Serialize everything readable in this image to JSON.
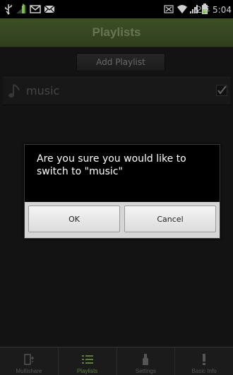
{
  "status_bar": {
    "time": "오후 5:04"
  },
  "header": {
    "title": "Playlists"
  },
  "toolbar": {
    "add_playlist_label": "Add Playlist"
  },
  "playlists": [
    {
      "name": "music",
      "checked": true
    }
  ],
  "dialog": {
    "message": "Are you sure you would like to switch to \"music\"",
    "ok_label": "OK",
    "cancel_label": "Cancel"
  },
  "tabs": [
    {
      "label": "Multishare",
      "icon": "multishare-icon",
      "active": false
    },
    {
      "label": "Playlists",
      "icon": "playlists-icon",
      "active": true
    },
    {
      "label": "Settings",
      "icon": "settings-icon",
      "active": false
    },
    {
      "label": "Basic Info",
      "icon": "basic-info-icon",
      "active": false
    }
  ],
  "colors": {
    "accent": "#5f7a3a",
    "title_text": "#9fb57d"
  }
}
